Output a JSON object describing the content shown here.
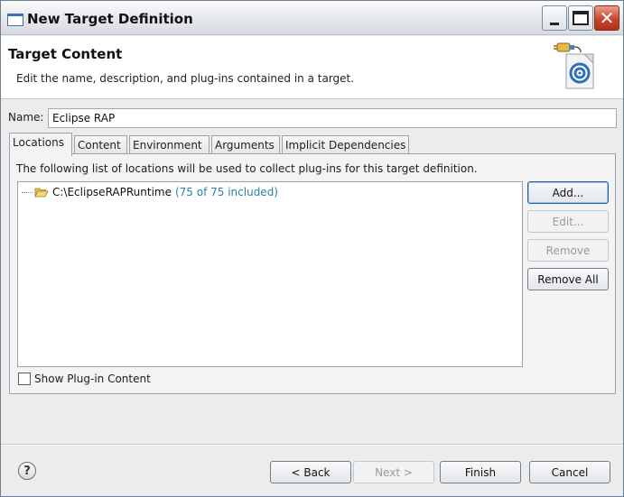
{
  "window": {
    "title": "New Target Definition",
    "icon": "window-icon"
  },
  "header": {
    "title": "Target Content",
    "description": "Edit the name, description, and plug-ins contained in a target.",
    "graphic_icon": "target-plugin-graphic"
  },
  "name_field": {
    "label": "Name:",
    "value": "Eclipse RAP"
  },
  "tabs": [
    {
      "label": "Locations",
      "active": true
    },
    {
      "label": "Content",
      "active": false
    },
    {
      "label": "Environment",
      "active": false
    },
    {
      "label": "Arguments",
      "active": false
    },
    {
      "label": "Implicit Dependencies",
      "active": false
    }
  ],
  "locations": {
    "description": "The following list of locations will be used to collect plug-ins for this target definition.",
    "items": [
      {
        "path": "C:\\EclipseRAPRuntime",
        "count": "(75 of 75 included)",
        "icon": "folder-open-icon"
      }
    ],
    "buttons": {
      "add": "Add...",
      "edit": "Edit...",
      "remove": "Remove",
      "remove_all": "Remove All"
    },
    "show_content_label": "Show Plug-in Content",
    "show_content_checked": false
  },
  "footer": {
    "help_icon": "help-icon",
    "back": "< Back",
    "next": "Next >",
    "finish": "Finish",
    "cancel": "Cancel"
  },
  "colors": {
    "count_text": "#2a7fa8",
    "close_button": "#c9452b"
  }
}
